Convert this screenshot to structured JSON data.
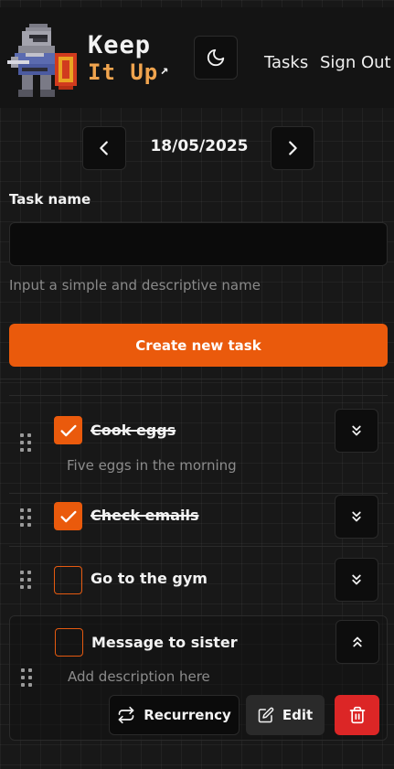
{
  "brand": {
    "line1": "Keep",
    "line2": "It Up",
    "arrow": "↗"
  },
  "nav": {
    "tasks": "Tasks",
    "sign_out": "Sign Out",
    "theme_icon": "moon-icon"
  },
  "date_nav": {
    "date": "18/05/2025",
    "prev_icon": "chevron-left-icon",
    "next_icon": "chevron-right-icon"
  },
  "form": {
    "label": "Task name",
    "value": "",
    "placeholder": "",
    "helper": "Input a simple and descriptive name",
    "submit_label": "Create new task"
  },
  "tasks": [
    {
      "name": "Cook eggs",
      "done": true,
      "description": "Five eggs in the morning",
      "expanded": false
    },
    {
      "name": "Check emails",
      "done": true,
      "description": "",
      "expanded": false
    },
    {
      "name": "Go to the gym",
      "done": false,
      "description": "",
      "expanded": false
    },
    {
      "name": "Message to sister",
      "done": false,
      "description": "Add description here",
      "expanded": true,
      "actions": {
        "recurrency": "Recurrency",
        "edit": "Edit"
      }
    }
  ],
  "colors": {
    "accent": "#ea5a0c",
    "danger": "#dc2626",
    "background": "#181818"
  }
}
